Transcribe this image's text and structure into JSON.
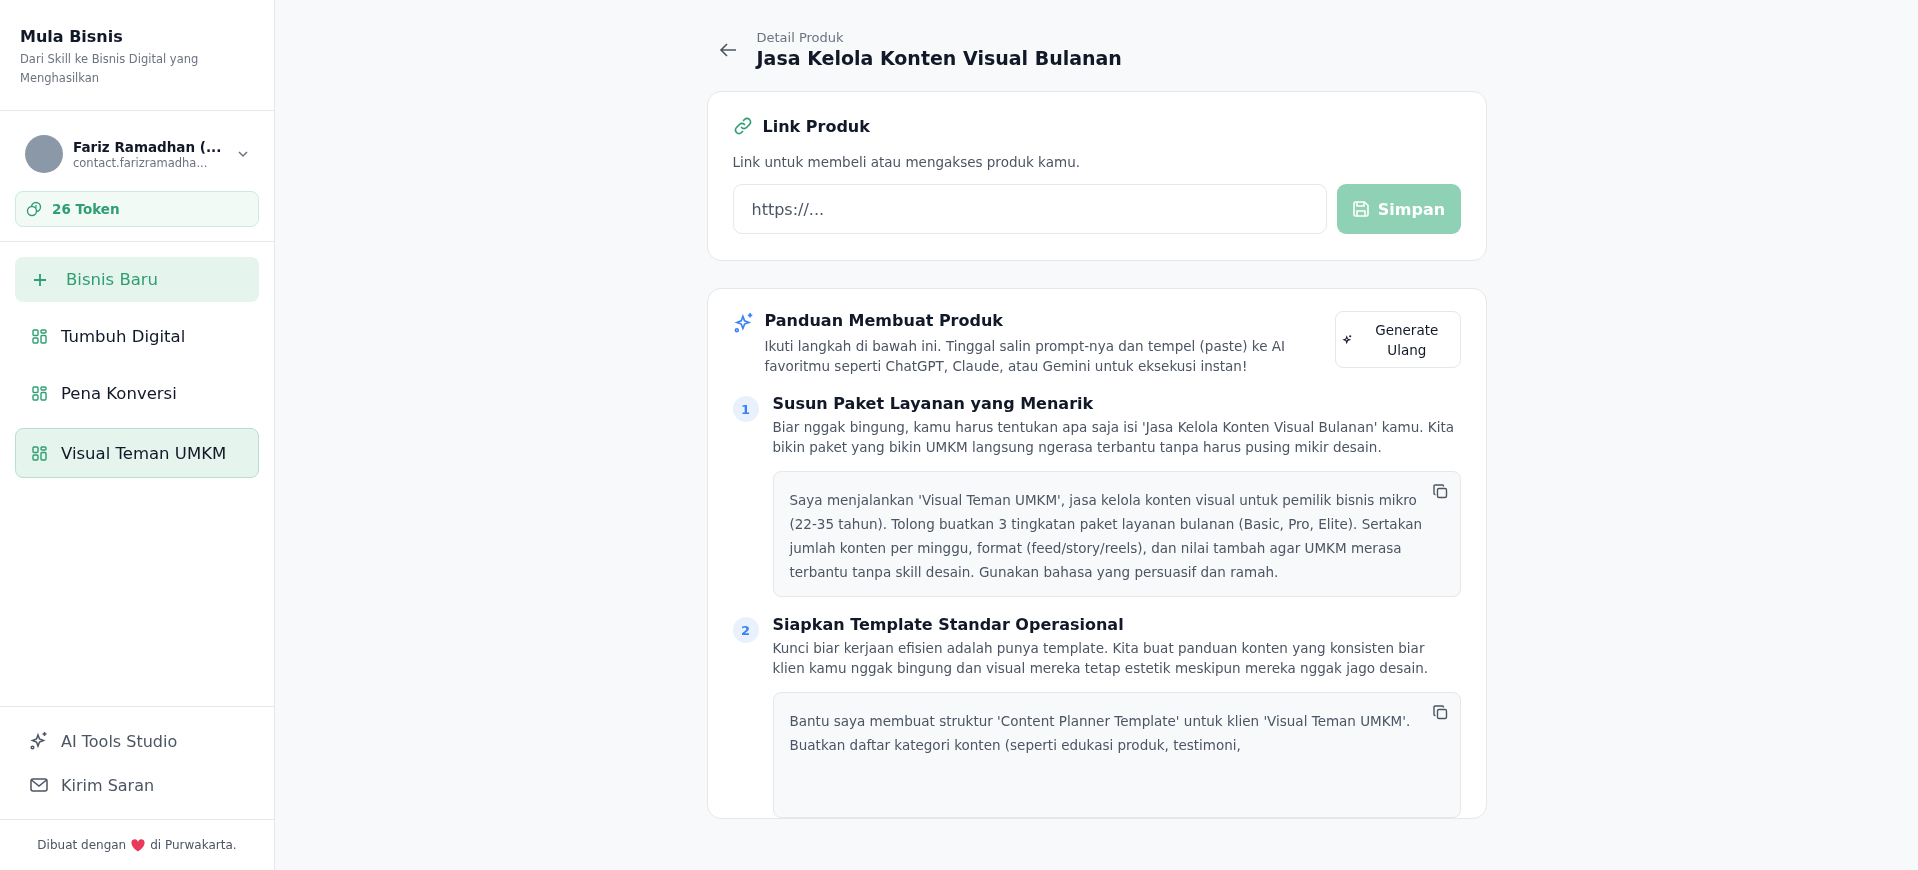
{
  "sidebar": {
    "brand": {
      "title": "Mula Bisnis",
      "subtitle": "Dari Skill ke Bisnis Digital yang Menghasilkan"
    },
    "user": {
      "name": "Fariz Ramadhan (...",
      "email": "contact.farizramadha..."
    },
    "tokens": "26 Token",
    "new_button": "Bisnis Baru",
    "items": [
      {
        "label": "Tumbuh Digital",
        "selected": false
      },
      {
        "label": "Pena Konversi",
        "selected": false
      },
      {
        "label": "Visual Teman UMKM",
        "selected": true
      }
    ],
    "bottom_links": [
      {
        "label": "AI Tools Studio",
        "kind": "sparkle"
      },
      {
        "label": "Kirim Saran",
        "kind": "mail"
      }
    ],
    "footer": {
      "before": "Dibuat dengan",
      "after": "di Purwakarta."
    }
  },
  "header": {
    "eyebrow": "Detail Produk",
    "title": "Jasa Kelola Konten Visual Bulanan"
  },
  "link_card": {
    "title": "Link Produk",
    "description": "Link untuk membeli atau mengakses produk kamu.",
    "field": {
      "placeholder": "https://..."
    },
    "save_button": {
      "label": "Simpan",
      "disabled": true
    }
  },
  "guide_card": {
    "title": "Panduan Membuat Produk",
    "description": "Ikuti langkah di bawah ini. Tinggal salin prompt-nya dan tempel (paste) ke AI favoritmu seperti ChatGPT, Claude, atau Gemini untuk eksekusi instan!",
    "regenerate_button": "Generate Ulang",
    "steps": [
      {
        "number": "1",
        "title": "Susun Paket Layanan yang Menarik",
        "description": "Biar nggak bingung, kamu harus tentukan apa saja isi 'Jasa Kelola Konten Visual Bulanan' kamu. Kita bikin paket yang bikin UMKM langsung ngerasa terbantu tanpa harus pusing mikir desain.",
        "prompt": "Saya menjalankan 'Visual Teman UMKM', jasa kelola konten visual untuk pemilik bisnis mikro (22-35 tahun). Tolong buatkan 3 tingkatan paket layanan bulanan (Basic, Pro, Elite). Sertakan jumlah konten per minggu, format (feed/story/reels), dan nilai tambah agar UMKM merasa terbantu tanpa skill desain. Gunakan bahasa yang persuasif dan ramah."
      },
      {
        "number": "2",
        "title": "Siapkan Template Standar Operasional",
        "description": "Kunci biar kerjaan efisien adalah punya template. Kita buat panduan konten yang konsisten biar klien kamu nggak bingung dan visual mereka tetap estetik meskipun mereka nggak jago desain.",
        "prompt": "Bantu saya membuat struktur 'Content Planner Template' untuk klien 'Visual Teman UMKM'. Buatkan daftar kategori konten (seperti edukasi produk, testimoni,"
      }
    ]
  }
}
